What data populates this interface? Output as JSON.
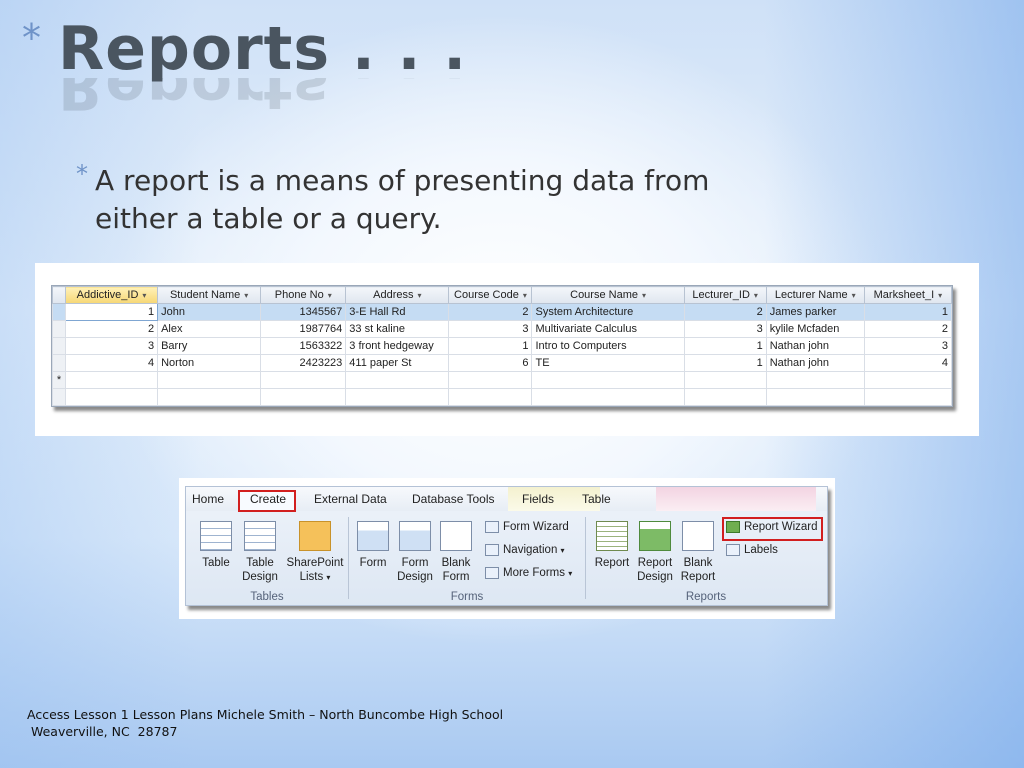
{
  "slide": {
    "title_star": "*",
    "title": "Reports . . .",
    "bullet_star": "*",
    "bullet": "A report is a means of presenting data from either a table or a query.",
    "footer_line1": "Access Lesson 1 Lesson Plans Michele Smith – North Buncombe High School",
    "footer_line2": " Weaverville, NC  28787"
  },
  "datasheet": {
    "columns": [
      "Addictive_ID",
      "Student Name",
      "Phone No",
      "Address",
      "Course Code",
      "Course Name",
      "Lecturer_ID",
      "Lecturer Name",
      "Marksheet_I"
    ],
    "rows": [
      [
        "1",
        "John",
        "1345567",
        "3-E Hall Rd",
        "2",
        "System Architecture",
        "2",
        "James parker",
        "1"
      ],
      [
        "2",
        "Alex",
        "1987764",
        "33 st kaline",
        "3",
        "Multivariate Calculus",
        "3",
        "kylile Mcfaden",
        "2"
      ],
      [
        "3",
        "Barry",
        "1563322",
        "3 front hedgeway",
        "1",
        "Intro to Computers",
        "1",
        "Nathan john",
        "3"
      ],
      [
        "4",
        "Norton",
        "2423223",
        "411 paper St",
        "6",
        "TE",
        "1",
        "Nathan john",
        "4"
      ]
    ],
    "new_row_marker": "*"
  },
  "ribbon": {
    "tabs": [
      "Home",
      "Create",
      "External Data",
      "Database Tools",
      "Fields",
      "Table"
    ],
    "groups": {
      "tables": {
        "label": "Tables",
        "buttons": [
          "Table",
          "Table Design",
          "SharePoint Lists"
        ]
      },
      "forms": {
        "label": "Forms",
        "buttons": [
          "Form",
          "Form Design",
          "Blank Form"
        ],
        "small": [
          "Form Wizard",
          "Navigation",
          "More Forms"
        ]
      },
      "reports": {
        "label": "Reports",
        "buttons": [
          "Report",
          "Report Design",
          "Blank Report"
        ],
        "small": [
          "Report Wizard",
          "Labels"
        ]
      }
    }
  },
  "colors": {
    "highlight": "#d21f1f",
    "accent": "#6f93c8"
  }
}
